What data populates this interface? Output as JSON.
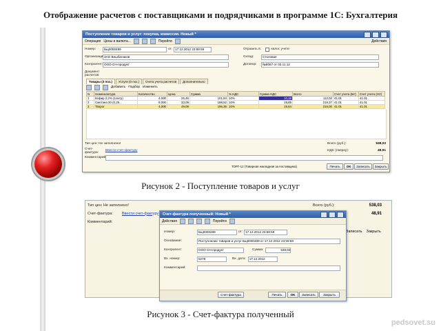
{
  "slide": {
    "title": "Отображение расчетов с поставщиками и подрядчиками в программе 1С: Бухгалтерия",
    "caption1": "Рисунок 2 - Поступление товаров и услуг",
    "caption2": "Рисунок 3 - Счет-фактура полученный",
    "watermark": "pedsovet.su"
  },
  "receipt": {
    "title": "Поступление товаров и услуг: покупка, комиссия. Новый *",
    "toolbar": [
      "Операция",
      "Цены и валюта...",
      "Перейти",
      "Действия"
    ],
    "number_label": "Номер:",
    "number": "Бщ0000489",
    "date_label": "от:",
    "date": "17.12.2012 23:59:59",
    "reflect_label": "Отразить в:",
    "reflect_value": "налог. учете",
    "org_label": "Организация:",
    "org": "ЗАО Бешбалаков",
    "warehouse_label": "Склад:",
    "warehouse": "Столовая",
    "contractor_label": "Контрагент:",
    "contractor": "ООО СН-продукт",
    "contract_label": "Договор:",
    "contract": "№8067 от 03.11.12",
    "doc_label": "Документ расчетов:",
    "tabs": [
      "Товары (3 поз.)",
      "Услуги (0 поз.)",
      "Счета учета расчетов",
      "Дополнительно"
    ],
    "table_toolbar": [
      "Добавить",
      "Подбор",
      "Изменить"
    ],
    "columns": [
      "N",
      "Номенклатура",
      "Количество",
      "Цена",
      "Сумма",
      "% НДС",
      "Сумма НДС",
      "Всего",
      "Счет учета (БУ)",
      "Счет учета (НУ)"
    ],
    "rows": [
      [
        "1",
        "Кефир 2,2% (1литр)",
        "4,000",
        "25,46",
        "101,84",
        "10%",
        "10,18",
        "112,02",
        "41.01",
        "41.01"
      ],
      [
        "2",
        "Сметана 20 (0,25...",
        "6,000",
        "33,09",
        "198,52",
        "10%",
        "19,85",
        "218,37",
        "41.01",
        "41.01"
      ],
      [
        "3",
        "Творог",
        "4,000",
        "49,09",
        "196,36",
        "10%",
        "19,64",
        "216,00",
        "41.01",
        "41.01"
      ]
    ],
    "invoice_type_label": "Тип цен: Не заполнено!",
    "invoice_label": "Счет-фактура:",
    "invoice_link": "Ввести счет-фактуру",
    "comment_label": "Комментарий:",
    "total_label": "Всего (руб.):",
    "total": "538,03",
    "vat_label": "НДС (сверху):",
    "vat": "48,91",
    "footer_print": "ТОРГ-12 (Товарная накладная за поставщика)",
    "buttons": [
      "Печать",
      "ОК",
      "Записать",
      "Закрыть"
    ]
  },
  "invoice_bg": {
    "type_label": "Тип цен: Не заполнено!",
    "invoice_label": "Счет-фактура:",
    "invoice_link": "Ввести счет-фактуру",
    "comment_label": "Комментарий:",
    "total_label": "Всего (руб.):",
    "total": "538,03",
    "vat_label": "НДС (сверху):",
    "vat": "48,91",
    "buttons": [
      "Печать",
      "OK",
      "Записать",
      "Закрыть"
    ]
  },
  "invoice": {
    "title": "Счет-фактура полученный: Новый *",
    "toolbar": [
      "Действия",
      "Перейти"
    ],
    "number_label": "Номер:",
    "number": "Бщ0000489",
    "date_label": "от:",
    "date": "17.12.2012 23:59:59",
    "basis_label": "Основание:",
    "basis": "Поступление товаров и услуг Бщ0000489 от 17.12.2012 23:59:59",
    "contractor_label": "Контрагент:",
    "contractor": "ООО СН-продукт",
    "sum_label": "Сумма:",
    "sum": "538,03",
    "in_number_label": "Вх. номер:",
    "in_number": "5278",
    "in_date_label": "Вх. дата:",
    "in_date": "17.12.2012",
    "comment_label": "Комментарий:",
    "buttons": [
      "Счет-фактура",
      "Печать",
      "OK",
      "Записать",
      "Закрыть"
    ]
  }
}
